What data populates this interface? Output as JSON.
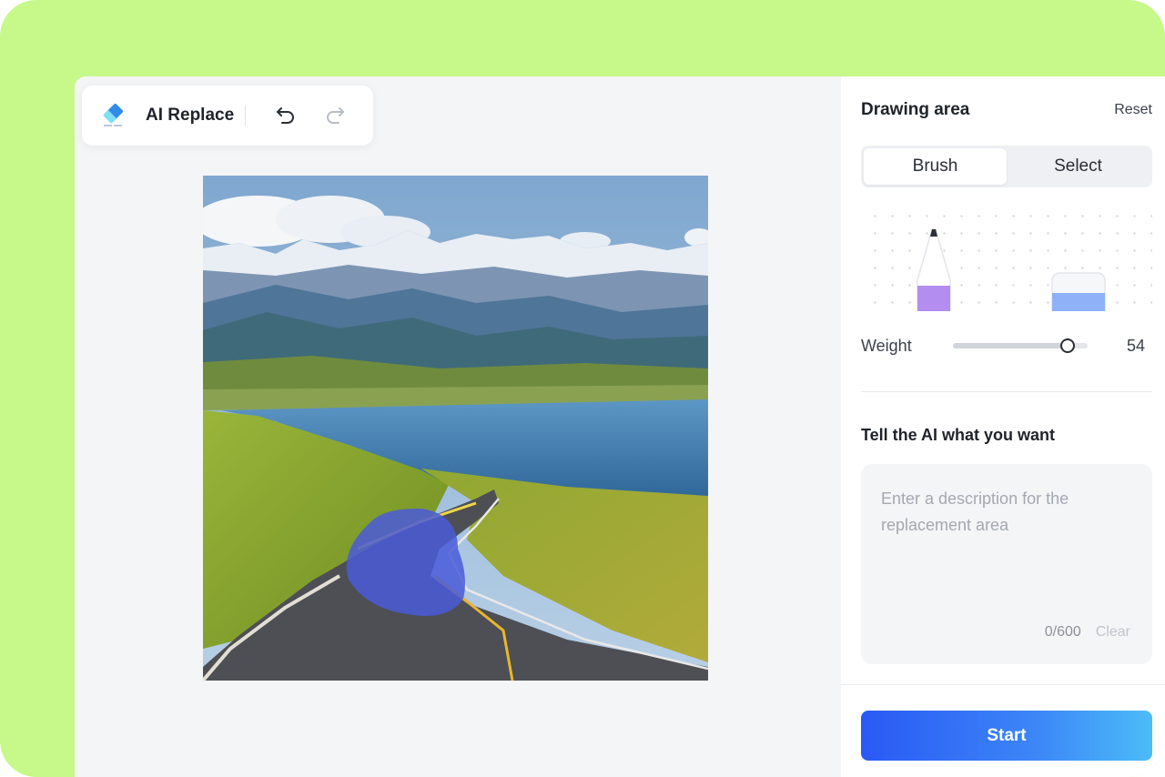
{
  "toolbar": {
    "tool_icon": "eraser-icon",
    "title": "AI Replace",
    "undo_icon": "undo-icon",
    "redo_icon": "redo-icon"
  },
  "canvas": {
    "image": "mountain-lake-road-photo",
    "mask_color": "#4a5bd8"
  },
  "panel": {
    "title": "Drawing area",
    "reset_label": "Reset",
    "modes": [
      {
        "label": "Brush",
        "active": true
      },
      {
        "label": "Select",
        "active": false
      }
    ],
    "tools": [
      {
        "name": "pencil-icon",
        "color": "#b38ef0",
        "selected": true
      },
      {
        "name": "eraser-icon",
        "color": "#8fb1f7",
        "selected": false
      }
    ],
    "weight": {
      "label": "Weight",
      "value": "54",
      "fraction": 0.85
    },
    "prompt": {
      "heading": "Tell the AI what you want",
      "placeholder": "Enter a description for the replacement area",
      "value": "",
      "counter": "0/600",
      "clear_label": "Clear"
    },
    "start_label": "Start"
  },
  "colors": {
    "background_accent": "#c6f88a",
    "button_gradient_start": "#2a59f5",
    "button_gradient_end": "#4cbcf8"
  }
}
